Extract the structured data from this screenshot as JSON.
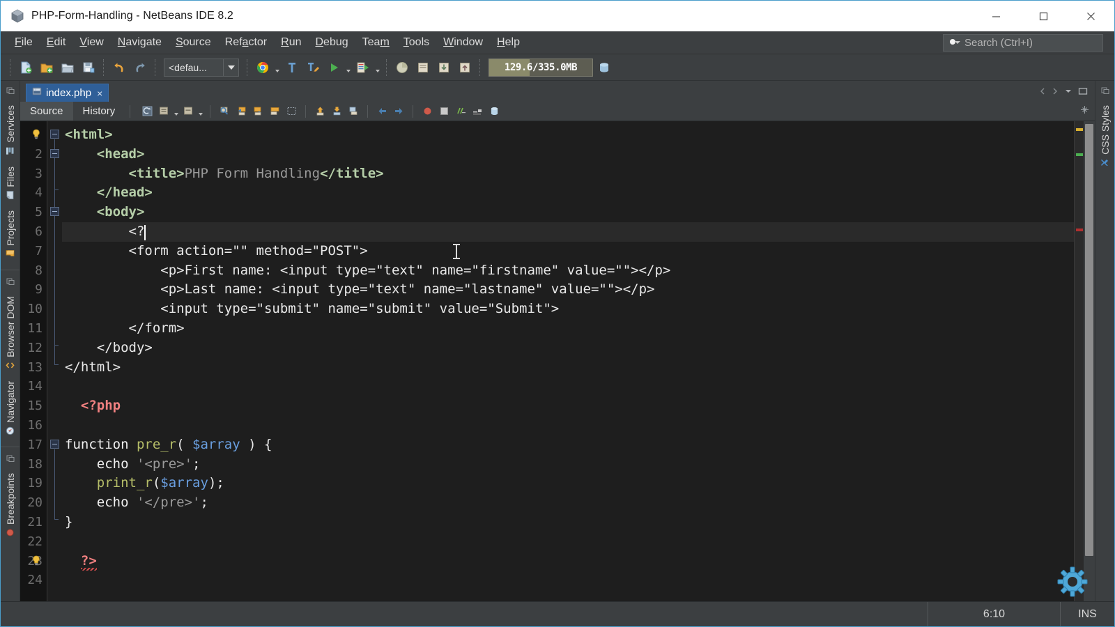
{
  "window": {
    "title": "PHP-Form-Handling - NetBeans IDE 8.2",
    "app_icon": "netbeans-cube-icon",
    "controls": {
      "minimize": "minimize-icon",
      "maximize": "maximize-icon",
      "close": "close-icon"
    }
  },
  "menubar": {
    "items": [
      {
        "label": "File",
        "mnemonic": "F"
      },
      {
        "label": "Edit",
        "mnemonic": "E"
      },
      {
        "label": "View",
        "mnemonic": "V"
      },
      {
        "label": "Navigate",
        "mnemonic": "N"
      },
      {
        "label": "Source",
        "mnemonic": "S"
      },
      {
        "label": "Refactor",
        "mnemonic": "a"
      },
      {
        "label": "Run",
        "mnemonic": "R"
      },
      {
        "label": "Debug",
        "mnemonic": "D"
      },
      {
        "label": "Team",
        "mnemonic": "m"
      },
      {
        "label": "Tools",
        "mnemonic": "T"
      },
      {
        "label": "Window",
        "mnemonic": "W"
      },
      {
        "label": "Help",
        "mnemonic": "H"
      }
    ]
  },
  "search": {
    "placeholder": "Search (Ctrl+I)",
    "icon": "search-icon"
  },
  "toolbar": {
    "buttons": [
      {
        "name": "new-file-button",
        "icon": "new-file-icon"
      },
      {
        "name": "new-project-button",
        "icon": "new-project-icon"
      },
      {
        "name": "open-project-button",
        "icon": "open-project-icon"
      },
      {
        "name": "save-all-button",
        "icon": "save-all-icon"
      },
      {
        "name": "undo-button",
        "icon": "undo-icon"
      },
      {
        "name": "redo-button",
        "icon": "redo-icon"
      }
    ],
    "config_combo": {
      "value": "<defau...",
      "name": "project-configuration-combo"
    },
    "run_buttons": [
      {
        "name": "run-project-button",
        "icon": "chrome-browser-icon"
      },
      {
        "name": "build-project-button",
        "icon": "hammer-icon"
      },
      {
        "name": "clean-build-button",
        "icon": "clean-build-icon"
      },
      {
        "name": "run-main-button",
        "icon": "play-icon"
      },
      {
        "name": "debug-project-button",
        "icon": "debug-icon"
      }
    ],
    "profile_buttons": [
      {
        "name": "profile-button",
        "icon": "profile-icon"
      },
      {
        "name": "attach-profiler-button",
        "icon": "attach-icon"
      },
      {
        "name": "team-update-button",
        "icon": "update-icon"
      },
      {
        "name": "team-commit-button",
        "icon": "commit-icon"
      }
    ],
    "memory": {
      "text": "129.6/335.0MB",
      "percent": 39,
      "name": "memory-gauge"
    },
    "gc_button": {
      "name": "garbage-collect-button",
      "icon": "gc-icon"
    }
  },
  "left_rail": {
    "groups": [
      {
        "tabs": [
          {
            "label": "Services",
            "icon": "services-icon"
          },
          {
            "label": "Files",
            "icon": "files-icon"
          },
          {
            "label": "Projects",
            "icon": "projects-icon"
          }
        ]
      },
      {
        "tabs": [
          {
            "label": "Browser DOM",
            "icon": "browser-dom-icon"
          },
          {
            "label": "Navigator",
            "icon": "navigator-icon"
          }
        ]
      },
      {
        "tabs": [
          {
            "label": "Breakpoints",
            "icon": "breakpoints-icon"
          }
        ]
      }
    ]
  },
  "right_rail": {
    "groups": [
      {
        "tabs": [
          {
            "label": "CSS Styles",
            "icon": "css-styles-icon"
          }
        ]
      }
    ]
  },
  "document_tabs": [
    {
      "label": "index.php",
      "icon": "php-file-icon",
      "active": true,
      "close": "×"
    }
  ],
  "editor_tabs": [
    {
      "label": "Source",
      "active": true
    },
    {
      "label": "History",
      "active": false
    }
  ],
  "editor_toolbar_icons": [
    "last-edit-icon",
    "toggle-rect-selection-icon",
    "toggle-highlight-icon",
    "find-selection-icon",
    "previous-bookmark-icon",
    "next-bookmark-icon",
    "toggle-bookmark-icon",
    "shift-line-left-icon",
    "previous-error-icon",
    "next-error-icon",
    "toggle-breakpoint-icon",
    "back-icon",
    "forward-icon",
    "stop-icon",
    "rectangle-icon",
    "comment-icon",
    "uncomment-icon",
    "db-icon"
  ],
  "code": {
    "cursor_line": 6,
    "cursor_col": 10,
    "lines": [
      {
        "n": 1,
        "tokens": [
          {
            "t": "tag",
            "v": "<html>"
          }
        ]
      },
      {
        "n": 2,
        "tokens": [
          {
            "t": "plain",
            "v": "    "
          },
          {
            "t": "tag",
            "v": "<head>"
          }
        ]
      },
      {
        "n": 3,
        "tokens": [
          {
            "t": "plain",
            "v": "        "
          },
          {
            "t": "tag",
            "v": "<title>"
          },
          {
            "t": "txt",
            "v": "PHP Form Handling"
          },
          {
            "t": "tag",
            "v": "</title>"
          }
        ]
      },
      {
        "n": 4,
        "tokens": [
          {
            "t": "plain",
            "v": "    "
          },
          {
            "t": "tag",
            "v": "</head>"
          }
        ]
      },
      {
        "n": 5,
        "tokens": [
          {
            "t": "plain",
            "v": "    "
          },
          {
            "t": "tag",
            "v": "<body>"
          }
        ]
      },
      {
        "n": 6,
        "tokens": [
          {
            "t": "plain",
            "v": "        "
          },
          {
            "t": "plain",
            "v": "<?"
          }
        ]
      },
      {
        "n": 7,
        "tokens": [
          {
            "t": "plain",
            "v": "        <form action=\"\" method=\"POST\">"
          }
        ]
      },
      {
        "n": 8,
        "tokens": [
          {
            "t": "plain",
            "v": "            <p>First name: <input type=\"text\" name=\"firstname\" value=\"\"></p>"
          }
        ]
      },
      {
        "n": 9,
        "tokens": [
          {
            "t": "plain",
            "v": "            <p>Last name: <input type=\"text\" name=\"lastname\" value=\"\"></p>"
          }
        ]
      },
      {
        "n": 10,
        "tokens": [
          {
            "t": "plain",
            "v": "            <input type=\"submit\" name=\"submit\" value=\"Submit\">"
          }
        ]
      },
      {
        "n": 11,
        "tokens": [
          {
            "t": "plain",
            "v": "        </form>"
          }
        ]
      },
      {
        "n": 12,
        "tokens": [
          {
            "t": "plain",
            "v": "    </body>"
          }
        ]
      },
      {
        "n": 13,
        "tokens": [
          {
            "t": "plain",
            "v": "</html>"
          }
        ]
      },
      {
        "n": 14,
        "tokens": []
      },
      {
        "n": 15,
        "tokens": [
          {
            "t": "plain",
            "v": "  "
          },
          {
            "t": "php",
            "v": "<?php"
          }
        ]
      },
      {
        "n": 16,
        "tokens": []
      },
      {
        "n": 17,
        "tokens": [
          {
            "t": "kw",
            "v": "function "
          },
          {
            "t": "fn",
            "v": "pre_r"
          },
          {
            "t": "punct",
            "v": "( "
          },
          {
            "t": "var",
            "v": "$array"
          },
          {
            "t": "punct",
            "v": " ) {"
          }
        ]
      },
      {
        "n": 18,
        "tokens": [
          {
            "t": "kw",
            "v": "    echo "
          },
          {
            "t": "str",
            "v": "'<pre>'"
          },
          {
            "t": "punct",
            "v": ";"
          }
        ]
      },
      {
        "n": 19,
        "tokens": [
          {
            "t": "plain",
            "v": "    "
          },
          {
            "t": "fn",
            "v": "print_r"
          },
          {
            "t": "punct",
            "v": "("
          },
          {
            "t": "var",
            "v": "$array"
          },
          {
            "t": "punct",
            "v": ");"
          }
        ]
      },
      {
        "n": 20,
        "tokens": [
          {
            "t": "kw",
            "v": "    echo "
          },
          {
            "t": "str",
            "v": "'</pre>'"
          },
          {
            "t": "punct",
            "v": ";"
          }
        ]
      },
      {
        "n": 21,
        "tokens": [
          {
            "t": "punct",
            "v": "}"
          }
        ]
      },
      {
        "n": 22,
        "tokens": []
      },
      {
        "n": 23,
        "tokens": [
          {
            "t": "plain",
            "v": "  "
          },
          {
            "t": "php",
            "v": "?>"
          }
        ]
      },
      {
        "n": 24,
        "tokens": []
      }
    ]
  },
  "annotations": {
    "hint_line": 1,
    "warning_line": 23,
    "error_squiggle_line": 23,
    "marks": [
      {
        "line": 1,
        "color": "#d8b030"
      },
      {
        "line": 5,
        "color": "#4caf50"
      },
      {
        "line": 17,
        "color": "#b03030"
      }
    ]
  },
  "statusbar": {
    "position": "6:10",
    "insert_mode": "INS"
  },
  "colors": {
    "accent": "#2f5f98",
    "chrome": "#3c3f41",
    "editor_bg": "#1e1e1e",
    "gutter_bg": "#141414",
    "tag": "#b5cea8",
    "php": "#f08080",
    "variable": "#6a9fe0",
    "function": "#b5bd68",
    "string": "#9a9a9a"
  }
}
